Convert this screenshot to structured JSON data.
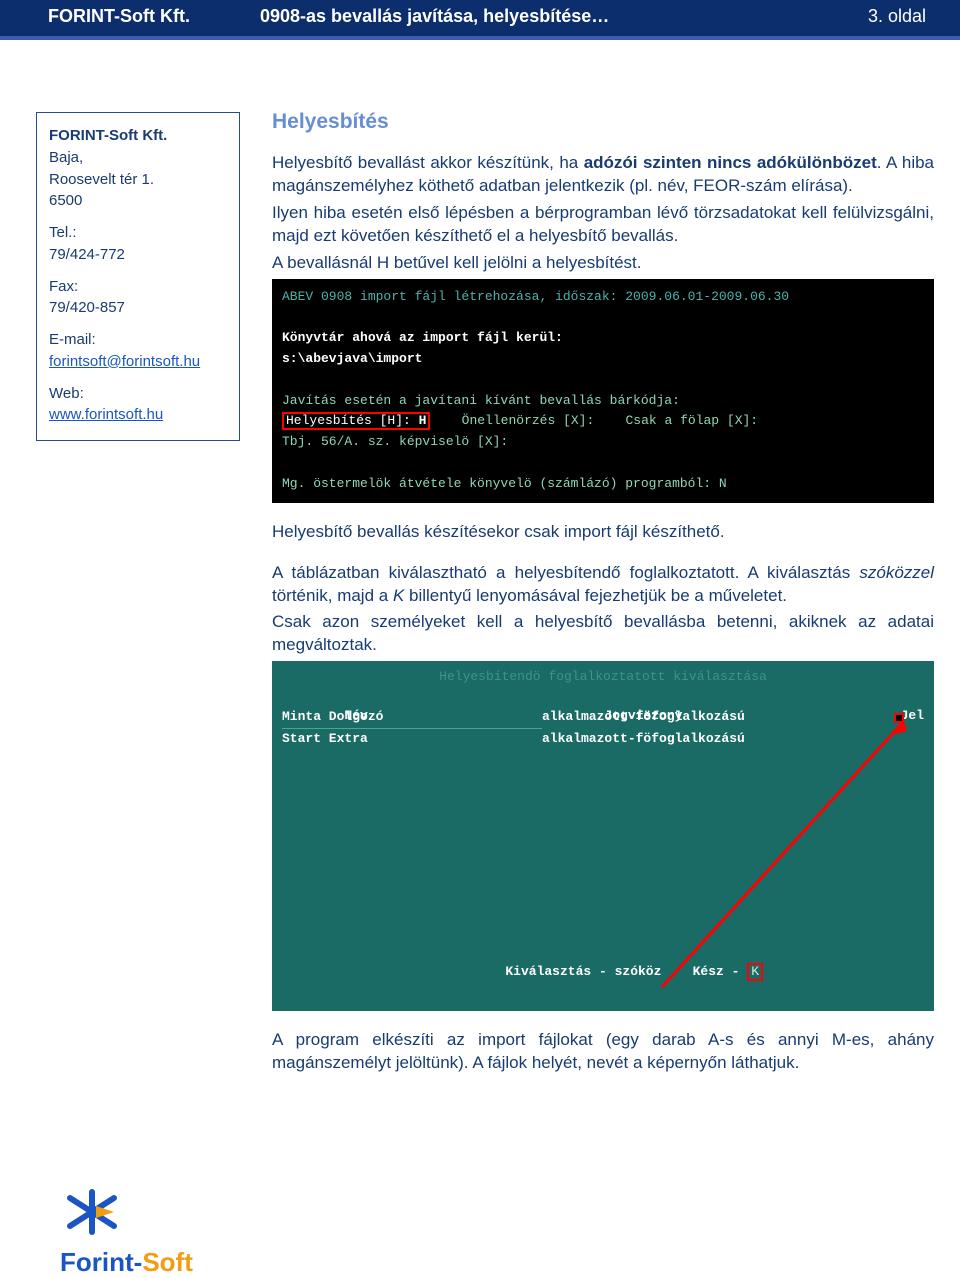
{
  "header": {
    "company": "FORINT-Soft Kft.",
    "title": "0908-as bevallás javítása, helyesbítése…",
    "pager": "3. oldal"
  },
  "sidebar": {
    "company": "FORINT-Soft Kft.",
    "address1": "Baja,",
    "address2": "Roosevelt tér 1.",
    "address3": "6500",
    "tel_label": "Tel.:",
    "tel": "79/424-772",
    "fax_label": "Fax:",
    "fax": "79/420-857",
    "email_label": "E-mail:",
    "email": "forintsoft@forintsoft.hu",
    "web_label": "Web:",
    "web": "www.forintsoft.hu"
  },
  "section_title": "Helyesbítés",
  "para1_a": "Helyesbítő bevallást akkor készítünk, ha ",
  "para1_b": "adózói szinten nincs adókülönbözet",
  "para1_c": ". A hiba magánszemélyhez köthető adatban jelentkezik (pl. név, FEOR-szám elírása).",
  "para2": "Ilyen hiba esetén első lépésben a bérprogramban lévő törzsadatokat kell felülvizsgálni, majd ezt követően készíthető el a helyesbítő bevallás.",
  "para3_a": "A bevallásnál ",
  "para3_b": "H",
  "para3_c": " betűvel kell jelölni a helyesbítést.",
  "term1": {
    "l1": "ABEV 0908 import fájl létrehozása, időszak: 2009.06.01-2009.06.30",
    "l2": "Könyvtár ahová az import fájl kerül:",
    "l3": "s:\\abevjava\\import",
    "l4": "Javítás esetén a javítani kívánt bevallás bárkódja:",
    "l5a": "Helyesbítés [H]:",
    "l5b": "H",
    "l5c": "    Önellenörzés [X]:    Csak a fölap [X]:",
    "l6": "Tbj. 56/A. sz. képviselö [X]:",
    "l7": "Mg. östermelök átvétele könyvelö (számlázó) programból: N"
  },
  "para4": "Helyesbítő bevallás készítésekor csak import fájl készíthető.",
  "para5_a": "A táblázatban kiválasztható a helyesbítendő foglalkoztatott. A kiválasztás ",
  "para5_b": "szóközzel",
  "para5_c": " történik, majd a ",
  "para5_d": "K",
  "para5_e": " billentyű lenyomásával fejezhetjük be a műveletet.",
  "para6": "Csak azon személyeket kell a helyesbítő bevallásba betenni, akiknek az adatai megváltoztak.",
  "term2": {
    "title": "Helyesbítendö foglalkoztatott kiválasztása",
    "col1": "Név",
    "col2": "Jogviszony",
    "col3": "Jel",
    "name1": "Minta Dolgozó",
    "job1": "alkalmazott-föfoglalkozású",
    "name2": "Start Extra",
    "job2": "alkalmazott-föfoglalkozású",
    "foot_a": "Kiválasztás - szóköz    Kész - ",
    "foot_b": "K"
  },
  "para7": "A program elkészíti az import fájlokat (egy darab A-s és annyi M-es, ahány magánszemélyt jelöltünk). A fájlok helyét, nevét a képernyőn láthatjuk.",
  "logo": {
    "f": "Forint-",
    "s": "Soft"
  }
}
